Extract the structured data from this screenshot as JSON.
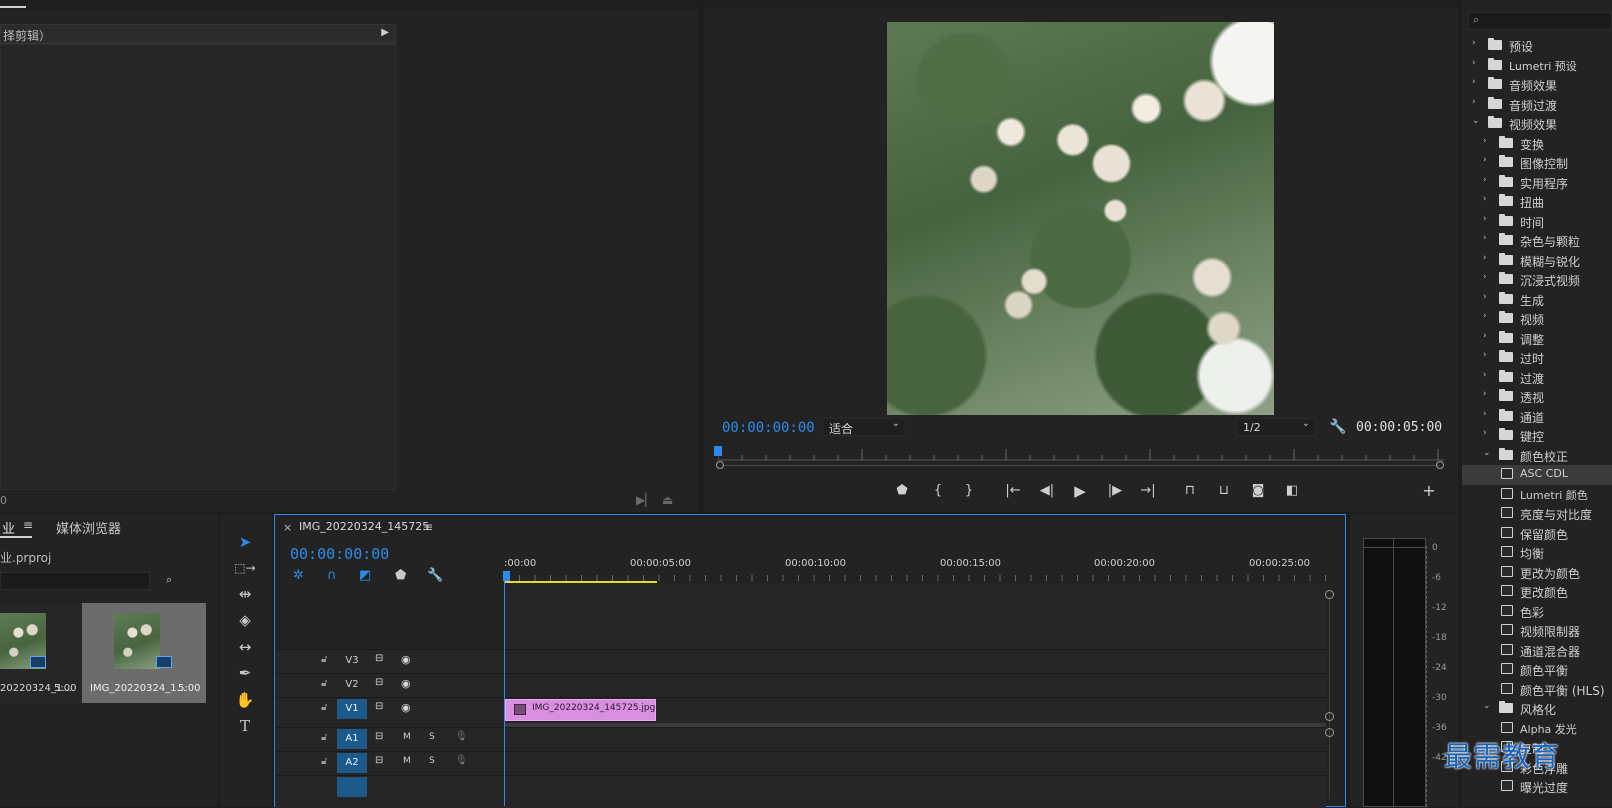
{
  "source": {
    "header_label": "择剪辑）",
    "footer_num": "0"
  },
  "program": {
    "timecode_current": "00:00:00:00",
    "fit_value": "适合",
    "resolution_value": "1/2",
    "timecode_duration": "00:00:05:00"
  },
  "project": {
    "tab_project": "业",
    "tab_media_browser": "媒体浏览器",
    "filename": "业.prproj",
    "items": [
      {
        "label": "20220324_1...",
        "duration": "5:00"
      },
      {
        "label": "IMG_20220324_1...",
        "duration": "5:00"
      }
    ]
  },
  "timeline": {
    "sequence_name": "IMG_20220324_145725",
    "timecode": "00:00:00:00",
    "ruler_labels": [
      ":00:00",
      "00:00:05:00",
      "00:00:10:00",
      "00:00:15:00",
      "00:00:20:00",
      "00:00:25:00"
    ],
    "tracks": {
      "v3": "V3",
      "v2": "V2",
      "v1": "V1",
      "a1": "A1",
      "a2": "A2",
      "mute": "M",
      "solo": "S"
    },
    "clip_label": "IMG_20220324_145725.jpg"
  },
  "meter": {
    "scale": [
      "0",
      "-6",
      "-12",
      "-18",
      "-24",
      "-30",
      "-36",
      "-42"
    ]
  },
  "effects": {
    "search_placeholder": "",
    "rows": [
      {
        "label": "预设",
        "kind": "folder",
        "expanded": false,
        "depth": 0
      },
      {
        "label": "Lumetri 预设",
        "kind": "folder",
        "expanded": false,
        "depth": 0
      },
      {
        "label": "音频效果",
        "kind": "folder",
        "expanded": false,
        "depth": 0
      },
      {
        "label": "音频过渡",
        "kind": "folder",
        "expanded": false,
        "depth": 0
      },
      {
        "label": "视频效果",
        "kind": "folder",
        "expanded": true,
        "depth": 0
      },
      {
        "label": "变换",
        "kind": "folder",
        "expanded": false,
        "depth": 1
      },
      {
        "label": "图像控制",
        "kind": "folder",
        "expanded": false,
        "depth": 1
      },
      {
        "label": "实用程序",
        "kind": "folder",
        "expanded": false,
        "depth": 1
      },
      {
        "label": "扭曲",
        "kind": "folder",
        "expanded": false,
        "depth": 1
      },
      {
        "label": "时间",
        "kind": "folder",
        "expanded": false,
        "depth": 1
      },
      {
        "label": "杂色与颗粒",
        "kind": "folder",
        "expanded": false,
        "depth": 1
      },
      {
        "label": "模糊与锐化",
        "kind": "folder",
        "expanded": false,
        "depth": 1
      },
      {
        "label": "沉浸式视频",
        "kind": "folder",
        "expanded": false,
        "depth": 1
      },
      {
        "label": "生成",
        "kind": "folder",
        "expanded": false,
        "depth": 1
      },
      {
        "label": "视频",
        "kind": "folder",
        "expanded": false,
        "depth": 1
      },
      {
        "label": "调整",
        "kind": "folder",
        "expanded": false,
        "depth": 1
      },
      {
        "label": "过时",
        "kind": "folder",
        "expanded": false,
        "depth": 1
      },
      {
        "label": "过渡",
        "kind": "folder",
        "expanded": false,
        "depth": 1
      },
      {
        "label": "透视",
        "kind": "folder",
        "expanded": false,
        "depth": 1
      },
      {
        "label": "通道",
        "kind": "folder",
        "expanded": false,
        "depth": 1
      },
      {
        "label": "键控",
        "kind": "folder",
        "expanded": false,
        "depth": 1
      },
      {
        "label": "颜色校正",
        "kind": "folder",
        "expanded": true,
        "depth": 1
      },
      {
        "label": "ASC CDL",
        "kind": "preset",
        "depth": 2,
        "selected": true
      },
      {
        "label": "Lumetri 颜色",
        "kind": "preset",
        "depth": 2
      },
      {
        "label": "亮度与对比度",
        "kind": "preset",
        "depth": 2
      },
      {
        "label": "保留颜色",
        "kind": "preset",
        "depth": 2
      },
      {
        "label": "均衡",
        "kind": "preset",
        "depth": 2
      },
      {
        "label": "更改为颜色",
        "kind": "preset",
        "depth": 2
      },
      {
        "label": "更改颜色",
        "kind": "preset",
        "depth": 2
      },
      {
        "label": "色彩",
        "kind": "preset",
        "depth": 2
      },
      {
        "label": "视频限制器",
        "kind": "preset",
        "depth": 2
      },
      {
        "label": "通道混合器",
        "kind": "preset",
        "depth": 2
      },
      {
        "label": "颜色平衡",
        "kind": "preset",
        "depth": 2
      },
      {
        "label": "颜色平衡 (HLS)",
        "kind": "preset",
        "depth": 2
      },
      {
        "label": "风格化",
        "kind": "folder",
        "expanded": true,
        "depth": 1
      },
      {
        "label": "Alpha 发光",
        "kind": "preset",
        "depth": 2
      },
      {
        "label": "复制",
        "kind": "preset",
        "depth": 2
      },
      {
        "label": "彩色浮雕",
        "kind": "preset",
        "depth": 2
      },
      {
        "label": "曝光过度",
        "kind": "preset",
        "depth": 2
      }
    ]
  },
  "watermark": "最需教育"
}
